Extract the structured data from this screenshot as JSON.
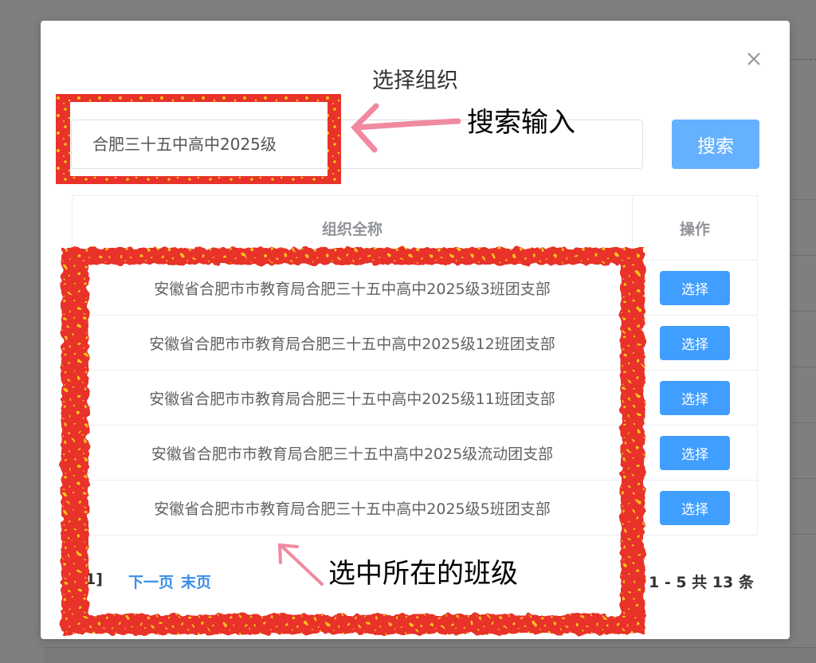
{
  "dialog": {
    "title": "选择组织",
    "close_icon": "close-icon"
  },
  "search": {
    "value": "合肥三十五中高中2025级",
    "button_label": "搜索"
  },
  "table": {
    "headers": {
      "name": "组织全称",
      "action": "操作"
    },
    "rows": [
      {
        "name": "安徽省合肥市市教育局合肥三十五中高中2025级3班团支部",
        "action": "选择"
      },
      {
        "name": "安徽省合肥市市教育局合肥三十五中高中2025级12班团支部",
        "action": "选择"
      },
      {
        "name": "安徽省合肥市市教育局合肥三十五中高中2025级11班团支部",
        "action": "选择"
      },
      {
        "name": "安徽省合肥市市教育局合肥三十五中高中2025级流动团支部",
        "action": "选择"
      },
      {
        "name": "安徽省合肥市市教育局合肥三十五中高中2025级5班团支部",
        "action": "选择"
      }
    ]
  },
  "pagination": {
    "bracket": "1]",
    "next_label": "下一页",
    "last_label": "末页",
    "summary": "1 - 5  共 13 条"
  },
  "annotations": {
    "search_note": "搜索输入",
    "select_note": "选中所在的班级",
    "frame_color": "#e8322a",
    "speckle_color": "#f5c518",
    "arrow_color": "#f08aa0"
  }
}
